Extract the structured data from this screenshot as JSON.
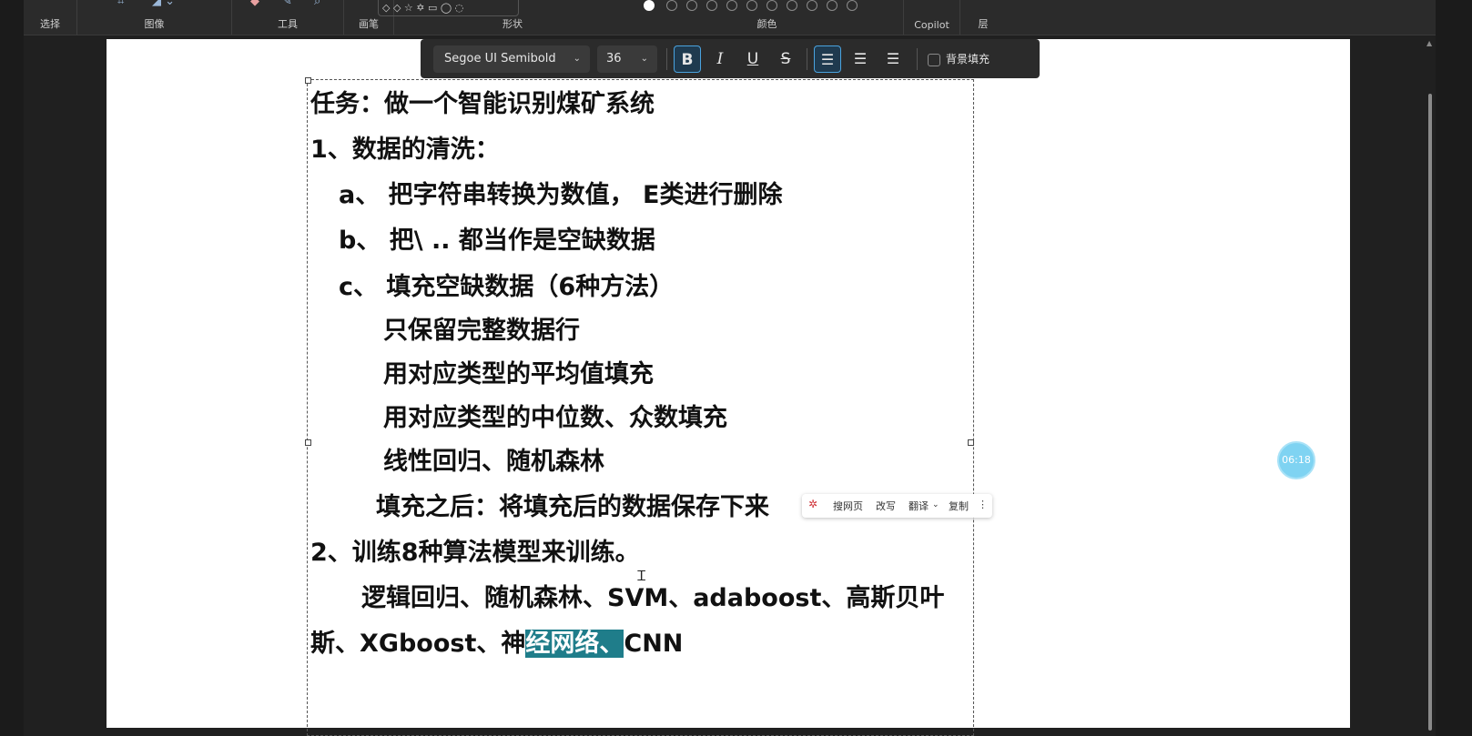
{
  "ribbon": {
    "groups": {
      "select": "选择",
      "image": "图像",
      "tools": "工具",
      "brush": "画笔",
      "shapes": "形状",
      "colors": "颜色",
      "copilot": "Copilot",
      "layers": "层"
    }
  },
  "format_bar": {
    "font_family": "Segoe UI Semibold",
    "font_size": "36",
    "bold_label": "B",
    "italic_label": "I",
    "underline_label": "U",
    "strike_label": "S",
    "background_fill_label": "背景填充"
  },
  "document": {
    "lines": [
      "任务：做一个智能识别煤矿系统",
      "1、数据的清洗：",
      "a、 把字符串转换为数值， E类进行删除",
      "b、 把\\ .. 都当作是空缺数据",
      "c、 填充空缺数据（6种方法）",
      "只保留完整数据行",
      "用对应类型的平均值填充",
      "用对应类型的中位数、众数填充",
      "线性回归、随机森林",
      "填充之后：将填充后的数据保存下来",
      "2、训练8种算法模型来训练。",
      "逻辑回归、随机森林、SVM、adaboost、高斯贝叶",
      "斯、XGboost、神",
      "经网络、",
      "CNN"
    ]
  },
  "mini_toolbar": {
    "search_web": "搜网页",
    "rewrite": "改写",
    "translate": "翻译",
    "copy": "复制"
  },
  "timer": "06:18",
  "colors": {
    "accent": "#4aa3df",
    "highlight": "#1f7d8a",
    "timer_bg": "#7fd3f2"
  }
}
